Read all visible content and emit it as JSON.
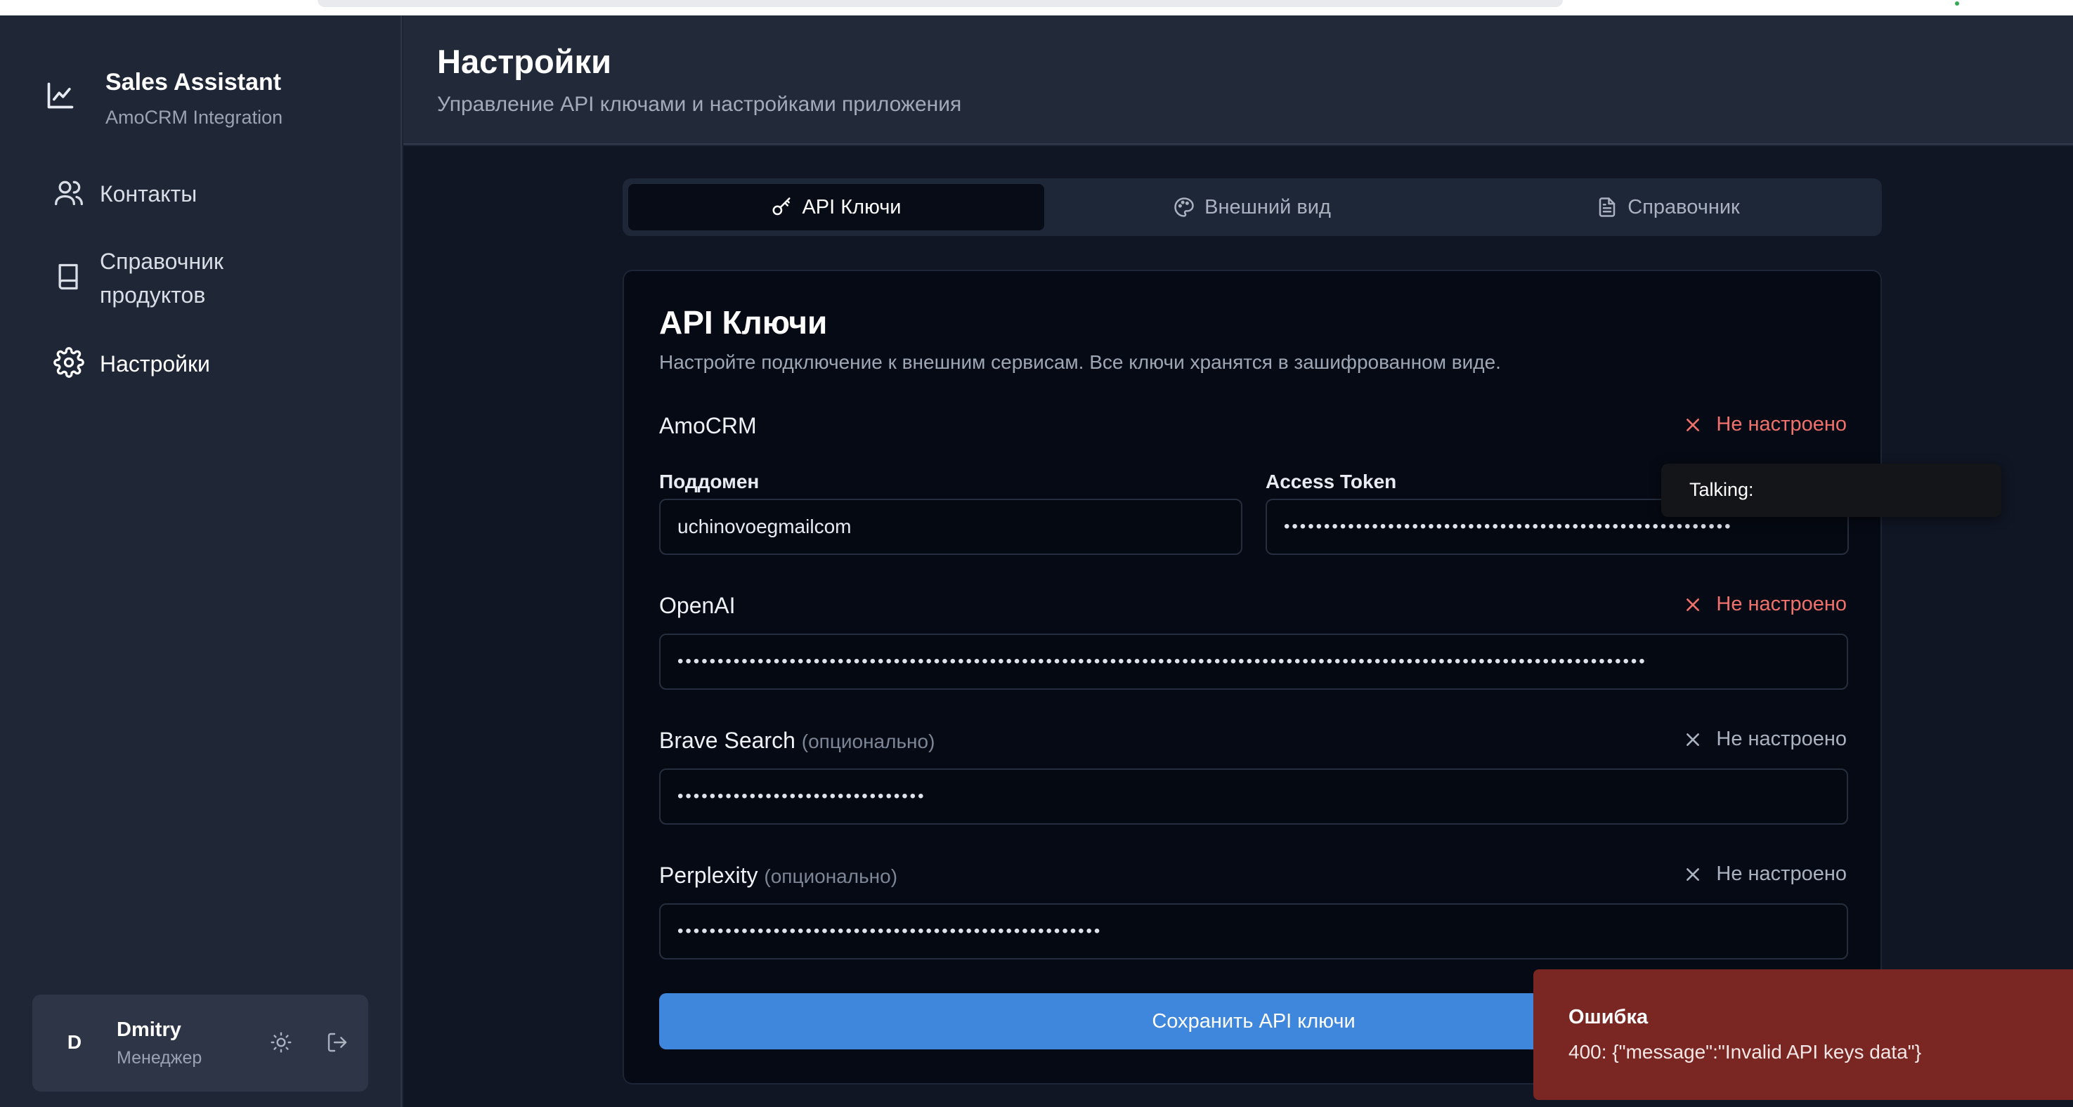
{
  "app": {
    "title": "Sales Assistant",
    "subtitle": "AmoCRM Integration"
  },
  "sidebar": {
    "items": [
      {
        "label": "Контакты",
        "icon": "users-icon"
      },
      {
        "label": "Справочник продуктов",
        "icon": "book-icon"
      },
      {
        "label": "Настройки",
        "icon": "gear-icon",
        "active": true
      }
    ]
  },
  "user": {
    "initial": "D",
    "name": "Dmitry",
    "role": "Менеджер"
  },
  "header": {
    "title": "Настройки",
    "subtitle": "Управление API ключами и настройками приложения"
  },
  "tabs": [
    {
      "label": "API Ключи",
      "icon": "key-icon",
      "active": true
    },
    {
      "label": "Внешний вид",
      "icon": "palette-icon"
    },
    {
      "label": "Справочник",
      "icon": "file-icon"
    }
  ],
  "card": {
    "title": "API Ключи",
    "description": "Настройте подключение к внешним сервисам. Все ключи хранятся в зашифрованном виде."
  },
  "sections": {
    "amocrm": {
      "title": "AmoCRM",
      "status": "Не настроено",
      "subdomain_label": "Поддомен",
      "subdomain_value": "uchinovoegmailcom",
      "token_label": "Access Token",
      "token_value": "••••••••••••••••••••••••••••••••••••••••••••••••••••••••"
    },
    "openai": {
      "title": "OpenAI",
      "status": "Не настроено",
      "key_value": "•••••••••••••••••••••••••••••••••••••••••••••••••••••••••••••••••••••••••••••••••••••••••••••••••••••••••••••••••••••••••"
    },
    "brave": {
      "title": "Brave Search",
      "optional": "(опционально)",
      "status": "Не настроено",
      "key_value": "•••••••••••••••••••••••••••••••"
    },
    "perplexity": {
      "title": "Perplexity",
      "optional": "(опционально)",
      "status": "Не настроено",
      "key_value": "•••••••••••••••••••••••••••••••••••••••••••••••••••••"
    }
  },
  "save_button": "Сохранить API ключи",
  "tooltip": "Talking:",
  "toast": {
    "title": "Ошибка",
    "message": "400: {\"message\":\"Invalid API keys data\"}"
  },
  "colors": {
    "accent": "#3f86dd",
    "error": "#f0716b",
    "toast_bg": "#7a2622"
  }
}
